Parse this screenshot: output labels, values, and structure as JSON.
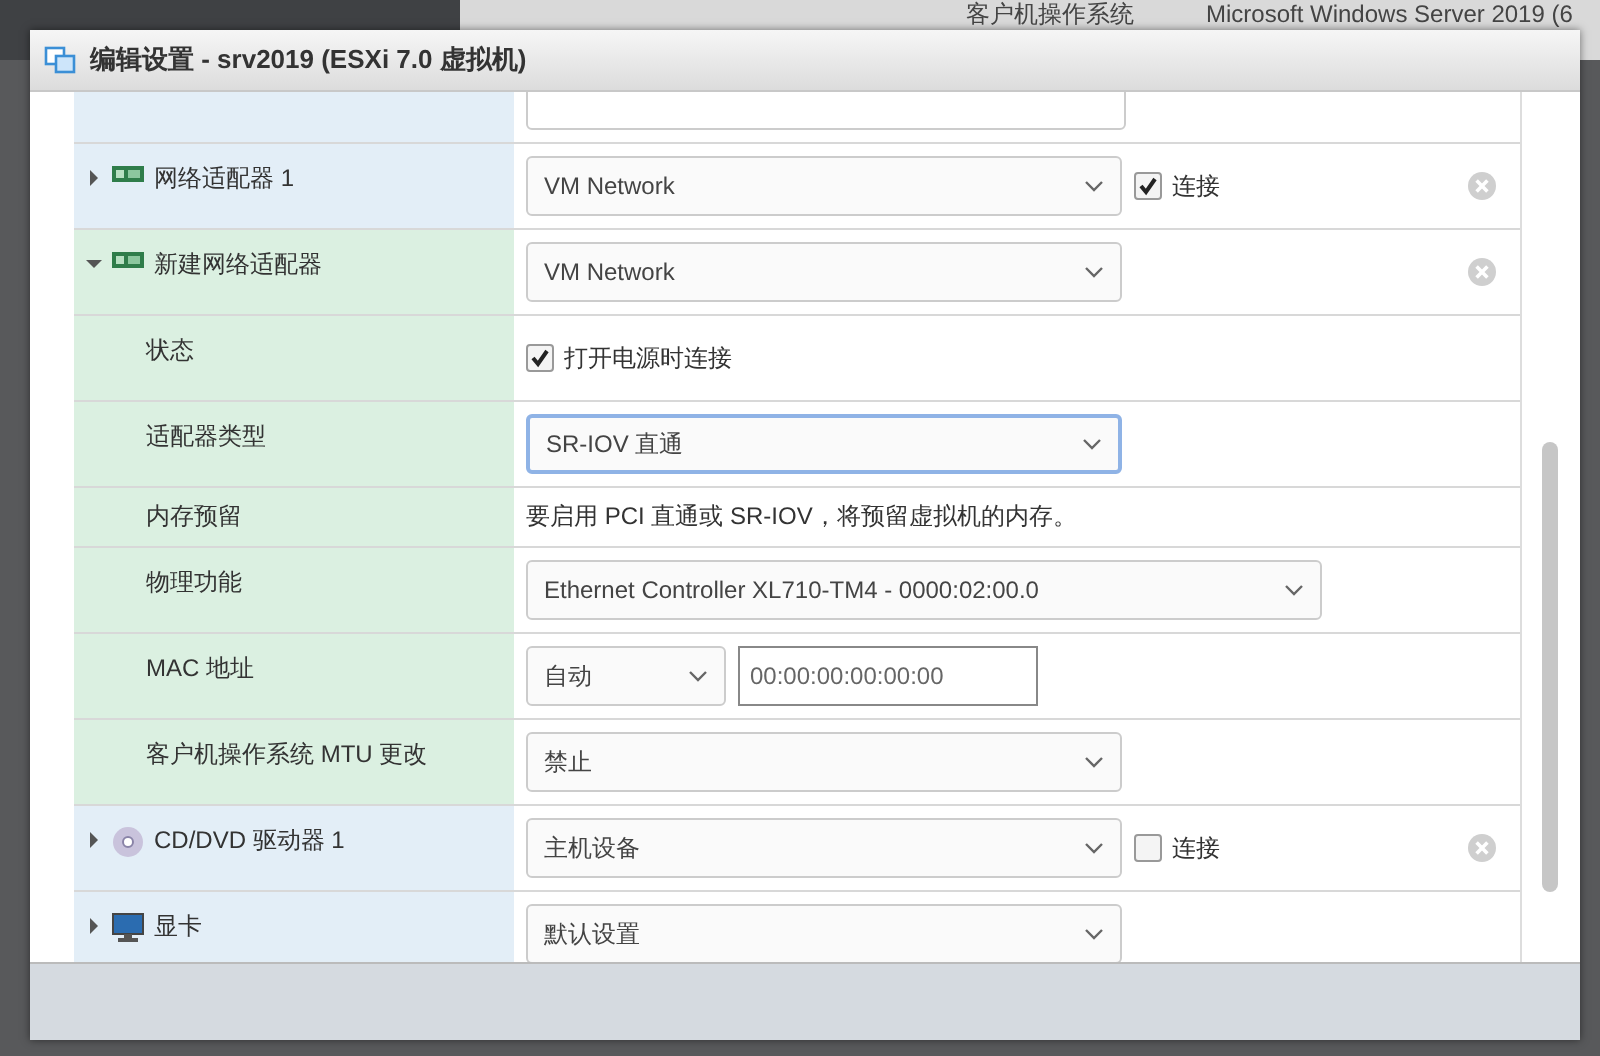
{
  "window": {
    "title": "编辑设置 - srv2019 (ESXi 7.0 虚拟机)"
  },
  "background": {
    "texts": [
      "客户机操作系统",
      "Microsoft Windows Server 2019 (6"
    ]
  },
  "devices": [
    {
      "kind": "network",
      "label": "网络适配器 1",
      "expanded": false,
      "removable": true,
      "controls": [
        {
          "kind": "select",
          "value": "VM Network",
          "focused": false
        },
        {
          "kind": "checkbox",
          "label": "连接",
          "checked": true
        }
      ]
    },
    {
      "kind": "network",
      "label": "新建网络适配器",
      "expanded": true,
      "removable": true,
      "controls": [
        {
          "kind": "select",
          "value": "VM Network",
          "focused": false
        }
      ],
      "children": [
        {
          "label": "状态",
          "controls": [
            {
              "kind": "checkbox",
              "label": "打开电源时连接",
              "checked": true
            }
          ]
        },
        {
          "label": "适配器类型",
          "controls": [
            {
              "kind": "select",
              "value": "SR-IOV 直通",
              "focused": true
            }
          ]
        },
        {
          "label": "内存预留",
          "controls": [
            {
              "kind": "note",
              "text": "要启用 PCI 直通或 SR-IOV，将预留虚拟机的内存。"
            }
          ]
        },
        {
          "label": "物理功能",
          "controls": [
            {
              "kind": "select-wide",
              "value": "Ethernet Controller XL710-TM4 - 0000:02:00.0",
              "focused": false
            }
          ]
        },
        {
          "label": "MAC 地址",
          "controls": [
            {
              "kind": "select-small",
              "value": "自动",
              "focused": false
            },
            {
              "kind": "input",
              "placeholder": "00:00:00:00:00:00"
            }
          ]
        },
        {
          "label": "客户机操作系统 MTU 更改",
          "controls": [
            {
              "kind": "select",
              "value": "禁止",
              "focused": false
            }
          ]
        }
      ]
    },
    {
      "kind": "cdrom",
      "label": "CD/DVD 驱动器 1",
      "expanded": false,
      "removable": true,
      "controls": [
        {
          "kind": "select",
          "value": "主机设备",
          "focused": false
        },
        {
          "kind": "checkbox",
          "label": "连接",
          "checked": false
        }
      ]
    },
    {
      "kind": "display",
      "label": "显卡",
      "expanded": false,
      "removable": false,
      "controls": [
        {
          "kind": "select",
          "value": "默认设置",
          "focused": false
        }
      ]
    }
  ]
}
